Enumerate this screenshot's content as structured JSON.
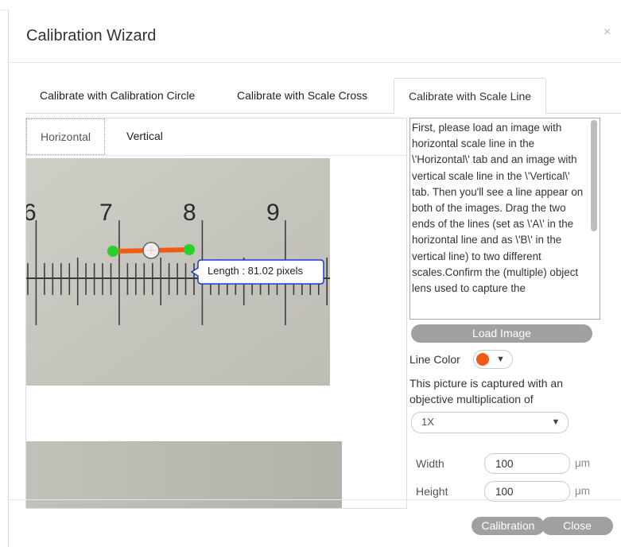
{
  "window": {
    "title": "Calibration Wizard",
    "close_glyph": "×"
  },
  "tabs": [
    {
      "label": "Calibrate with Calibration Circle"
    },
    {
      "label": "Calibrate with Scale Cross"
    },
    {
      "label": "Calibrate with Scale Line"
    }
  ],
  "active_tab": 2,
  "subtabs": [
    {
      "label": "Horizontal"
    },
    {
      "label": "Vertical"
    }
  ],
  "active_subtab": 0,
  "image": {
    "scale_numbers": [
      "6",
      "7",
      "8",
      "9"
    ],
    "tooltip": "Length : 81.02 pixels"
  },
  "help_text": "First, please load an image with horizontal scale line in the \\'Horizontal\\' tab and an image with vertical scale line in the \\'Vertical\\' tab. Then you'll see a line appear on both of the images. Drag the two ends of the lines (set as \\'A\\' in the horizontal line and as \\'B\\' in the vertical line) to two different scales.Confirm the (multiple) object lens used to capture the",
  "load_image_label": "Load Image",
  "line_color": {
    "label": "Line Color",
    "value": "#f25a13"
  },
  "captured_text": "This picture is captured with an objective multiplication of",
  "objective": {
    "selected": "1X"
  },
  "width": {
    "label": "Width",
    "value": "100",
    "unit": "μm"
  },
  "height": {
    "label": "Height",
    "value": "100",
    "unit": "μm"
  },
  "footer": {
    "calibration_label": "Calibration",
    "close_label": "Close"
  },
  "colors": {
    "line": "#f25a13",
    "handle": "#27d12a",
    "button": "#a0a0a0",
    "tooltip_border": "#1a3bd6"
  },
  "icons": {
    "close": "close-icon",
    "dropdown": "chevron-down-icon"
  }
}
